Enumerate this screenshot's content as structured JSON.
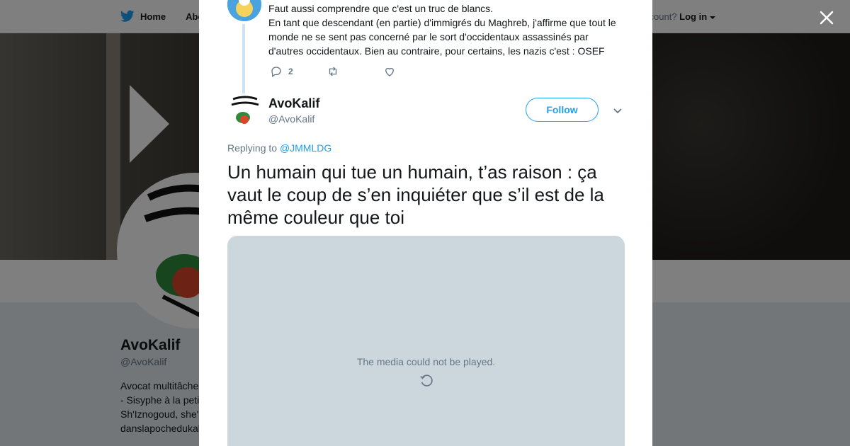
{
  "header": {
    "home_label": "Home",
    "about_label": "Abo",
    "account_prompt": "ccount?",
    "login_label": "Log in"
  },
  "profile": {
    "name": "AvoKalif",
    "handle": "@AvoKalif",
    "bio_lines": [
      "Avocat multitâche",
      "- Sisyphe à la peti",
      "Sh'Iznogoud, she'",
      "danslapochedukal"
    ]
  },
  "previous_tweet": {
    "line1": "Faut aussi comprendre que c'est un truc de blancs.",
    "body": "En tant que descendant (en partie) d'immigrés du Maghreb, j'affirme que tout le monde ne se sent pas concerné par le sort d'occidentaux assassinés par d'autres occidentaux. Bien au contraire, pour certains, les nazis c'est : OSEF",
    "reply_count": "2"
  },
  "tweet": {
    "author_name": "AvoKalif",
    "author_handle": "@AvoKalif",
    "follow_label": "Follow",
    "replying_prefix": "Replying to",
    "replying_to": "@JMMLDG",
    "text": "Un humain qui tue un humain, t’as raison : ça vaut le coup de s’en inquiéter que s’il est de la même couleur que toi",
    "media_error": "The media could not be played."
  },
  "colors": {
    "accent": "#1da1f2",
    "text": "#14171a",
    "muted": "#657786",
    "media_bg": "#ccd6dd"
  },
  "icons": [
    "twitter-bird-icon",
    "caret-down-icon",
    "close-icon",
    "reply-icon",
    "retweet-icon",
    "like-icon",
    "chevron-down-icon",
    "retry-icon"
  ]
}
